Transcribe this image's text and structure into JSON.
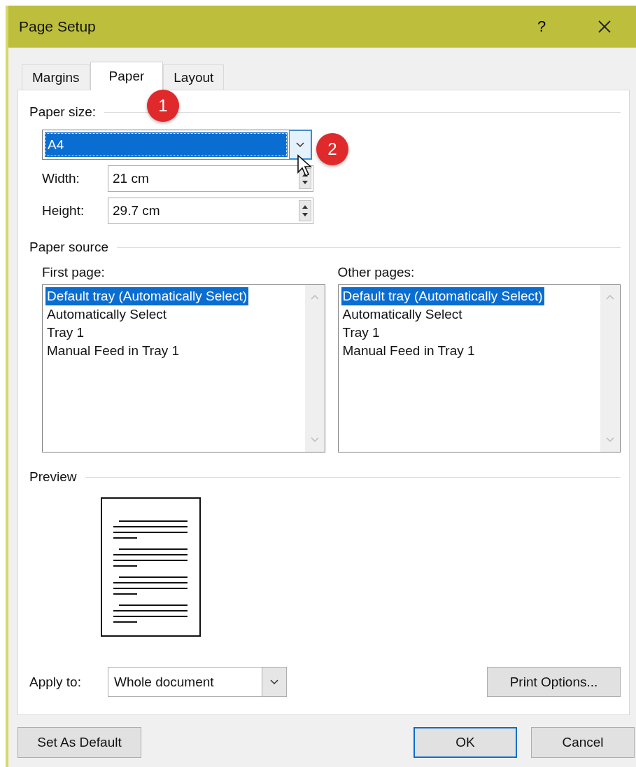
{
  "window": {
    "title": "Page Setup",
    "help": "?"
  },
  "tabs": [
    {
      "label": "Margins",
      "selected": false
    },
    {
      "label": "Paper",
      "selected": true
    },
    {
      "label": "Layout",
      "selected": false
    }
  ],
  "paper_size": {
    "label": "Paper size:",
    "value": "A4",
    "width": {
      "label": "Width:",
      "value": "21 cm"
    },
    "height": {
      "label": "Height:",
      "value": "29.7 cm"
    }
  },
  "paper_source": {
    "label": "Paper source",
    "lists": [
      {
        "label": "First page:",
        "items": [
          {
            "label": "Default tray (Automatically Select)",
            "selected": true
          },
          {
            "label": "Automatically Select",
            "selected": false
          },
          {
            "label": "Tray 1",
            "selected": false
          },
          {
            "label": "Manual Feed in Tray 1",
            "selected": false
          }
        ]
      },
      {
        "label": "Other pages:",
        "items": [
          {
            "label": "Default tray (Automatically Select)",
            "selected": true
          },
          {
            "label": "Automatically Select",
            "selected": false
          },
          {
            "label": "Tray 1",
            "selected": false
          },
          {
            "label": "Manual Feed in Tray 1",
            "selected": false
          }
        ]
      }
    ]
  },
  "preview": {
    "label": "Preview"
  },
  "apply_to": {
    "label": "Apply to:",
    "value": "Whole document"
  },
  "print_options": "Print Options...",
  "buttons": [
    {
      "label": "Set As Default",
      "default": false
    },
    {
      "label": "OK",
      "default": true
    },
    {
      "label": "Cancel",
      "default": false
    }
  ],
  "callouts": [
    "1",
    "2"
  ]
}
